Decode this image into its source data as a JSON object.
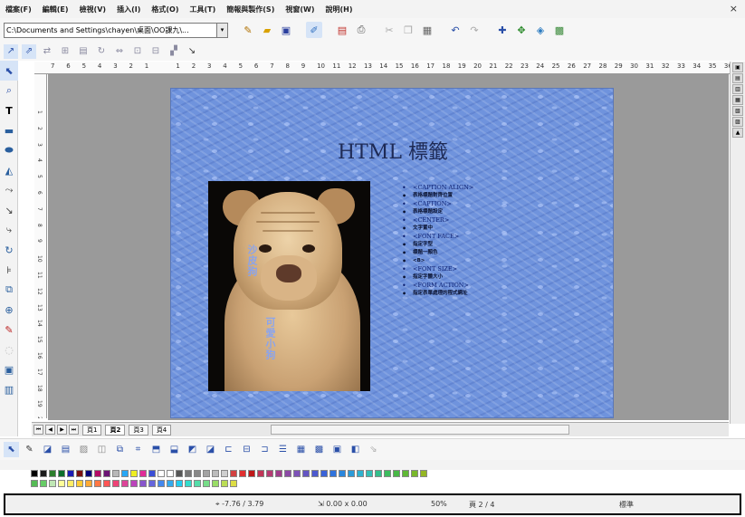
{
  "menu": {
    "items": [
      "檔案(F)",
      "編輯(E)",
      "檢視(V)",
      "插入(I)",
      "格式(O)",
      "工具(T)",
      "簡報與製作(S)",
      "視窗(W)",
      "說明(H)"
    ],
    "close_label": "×"
  },
  "toolbar1": {
    "path_value": "C:\\Documents and Settings\\chayen\\桌面\\OO課九\\...",
    "path_dropdown": "▾"
  },
  "slide": {
    "title": "HTML 標籤",
    "image_caption_1": "沙皮狗",
    "image_caption_2": "可愛小狗",
    "bullets": [
      {
        "text": "<CAPTION ALIGN>",
        "kind": "tag"
      },
      {
        "text": "表格標題對齊位置",
        "kind": "desc"
      },
      {
        "text": "<CAPTION>",
        "kind": "tag"
      },
      {
        "text": "表格標題設定",
        "kind": "desc"
      },
      {
        "text": "<CENTER>",
        "kind": "tag"
      },
      {
        "text": "文字置中",
        "kind": "desc"
      },
      {
        "text": "<FONT FACE>",
        "kind": "tag"
      },
      {
        "text": "指定字型",
        "kind": "desc"
      },
      {
        "text": "標題一顏色",
        "kind": "desc"
      },
      {
        "text": "<B>",
        "kind": "desc"
      },
      {
        "text": "<FONT SIZE>",
        "kind": "tag"
      },
      {
        "text": "指定字體大小",
        "kind": "desc"
      },
      {
        "text": "<FORM ACTION>",
        "kind": "tag"
      },
      {
        "text": "指定表單處理的程式網址",
        "kind": "desc"
      }
    ]
  },
  "sheet_tabs": {
    "tabs": [
      "頁1",
      "頁2",
      "頁3",
      "頁4"
    ],
    "active_index": 1
  },
  "statusbar": {
    "position": "-7.76 / 3.79",
    "size": "0.00 x 0.00",
    "zoom": "50%",
    "page": "頁 2 / 4",
    "style": "標準"
  },
  "ruler": {
    "h_labels": [
      "7",
      "6",
      "5",
      "4",
      "3",
      "2",
      "1",
      "",
      "1",
      "2",
      "3",
      "4",
      "5",
      "6",
      "7",
      "8",
      "9",
      "10",
      "11",
      "12",
      "13",
      "14",
      "15",
      "16",
      "17",
      "18",
      "19",
      "20",
      "21",
      "22",
      "23",
      "24",
      "25",
      "26",
      "27",
      "28",
      "29",
      "30",
      "31",
      "32",
      "33",
      "34",
      "35",
      "36"
    ],
    "v_labels": [
      "1",
      "2",
      "3",
      "4",
      "5",
      "6",
      "7",
      "8",
      "9",
      "10",
      "11",
      "12",
      "13",
      "14",
      "15",
      "16",
      "17",
      "18",
      "19",
      "20",
      "21"
    ]
  },
  "palette": {
    "row1": [
      "#000000",
      "#1a1a1a",
      "#2c7d2c",
      "#0c6e2b",
      "#1b1bb3",
      "#7a0f0f",
      "#00007a",
      "#b30b66",
      "#6b1575",
      "#b8b8b8",
      "#28a7f5",
      "#eeee22",
      "#e02c98",
      "#3b4fd6",
      "#ffffff",
      "#ffffff",
      "#555555",
      "#777777",
      "#888888",
      "#a3a3a3",
      "#bcbcbc",
      "#cfcfcf",
      "#d14141",
      "#e03030",
      "#c01818",
      "#c23557",
      "#b63a73",
      "#a03c8c",
      "#8c4aa6",
      "#7d52b8",
      "#6455c3",
      "#4c59cf",
      "#3a63d8",
      "#2f73dd",
      "#2a86dd",
      "#2b9bd9",
      "#2eb2cf",
      "#33bfb5",
      "#34bf8c",
      "#3cbc5f",
      "#48b846",
      "#5fb835",
      "#79b82a",
      "#94b623"
    ],
    "row2": [
      "#55bb55",
      "#66cc66",
      "#bfe7b5",
      "#ffff99",
      "#ffee66",
      "#ffcc33",
      "#ffaa33",
      "#ff7744",
      "#ff5555",
      "#ee4477",
      "#dd4499",
      "#bb44bb",
      "#8855cc",
      "#6666dd",
      "#4488ee",
      "#33aaee",
      "#22ccee",
      "#33ddcc",
      "#55ddaa",
      "#77dd88",
      "#99dd66",
      "#bbdd55",
      "#dddd44"
    ]
  }
}
